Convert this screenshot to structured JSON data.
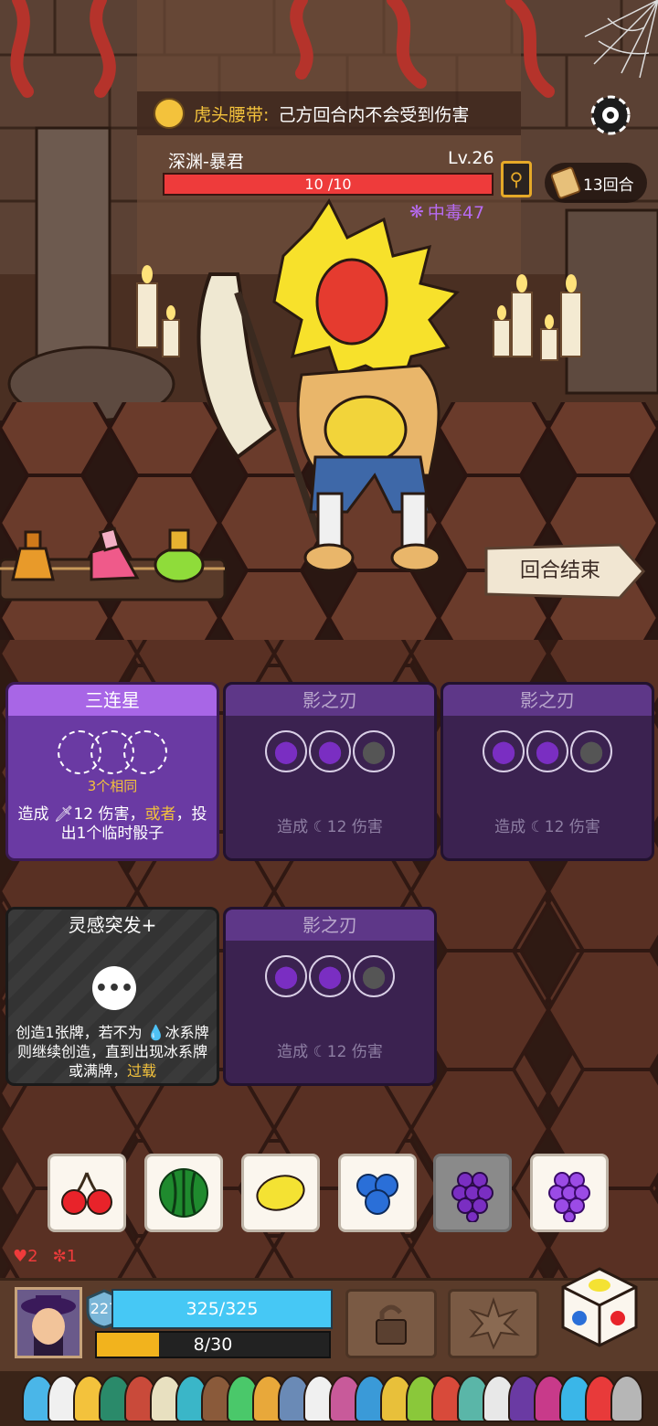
{
  "relic": {
    "name": "虎头腰带:",
    "effect": "己方回合内不会受到伤害"
  },
  "enemy": {
    "name": "深渊-暴君",
    "level": "Lv.26",
    "hp_text": "10 /10",
    "hp_fraction": 1.0,
    "status": "中毒47"
  },
  "turn_counter": "13回合",
  "end_turn_label": "回合结束",
  "cards": [
    {
      "title": "三连星",
      "sub": "3个相同",
      "desc_a": "造成 ",
      "desc_b": "12 伤害，",
      "desc_c": "或者",
      "desc_d": "，投出1个临时骰子"
    },
    {
      "title": "影之刃",
      "desc": "造成 ",
      "dmg": "12",
      "unit": " 伤害"
    },
    {
      "title": "影之刃",
      "desc": "造成 ",
      "dmg": "12",
      "unit": " 伤害"
    },
    {
      "title": "灵感突发+",
      "desc_a": "创造1张牌，若不为 ",
      "desc_b": "冰系牌则继续创造，直到出现冰系牌或满牌，",
      "desc_c": "过载"
    },
    {
      "title": "影之刃",
      "desc": "造成 ",
      "dmg": "12",
      "unit": " 伤害"
    }
  ],
  "dice": [
    {
      "face": "cherry-icon"
    },
    {
      "face": "watermelon-icon"
    },
    {
      "face": "lemon-icon"
    },
    {
      "face": "blueberry-icon"
    },
    {
      "face": "grape-icon",
      "selected": true
    },
    {
      "face": "grape-icon"
    }
  ],
  "player": {
    "armor": "227",
    "hp_text": "325/325",
    "xp_text": "8/30",
    "xp_fraction": 0.2667,
    "heart_count": "2",
    "spiral_count": "1"
  },
  "colors": {
    "accent_purple": "#a866e6",
    "gold": "#f3c23c",
    "hp_red": "#ee3b3b",
    "hp_blue": "#46c8f5",
    "poison": "#b76bf2"
  }
}
